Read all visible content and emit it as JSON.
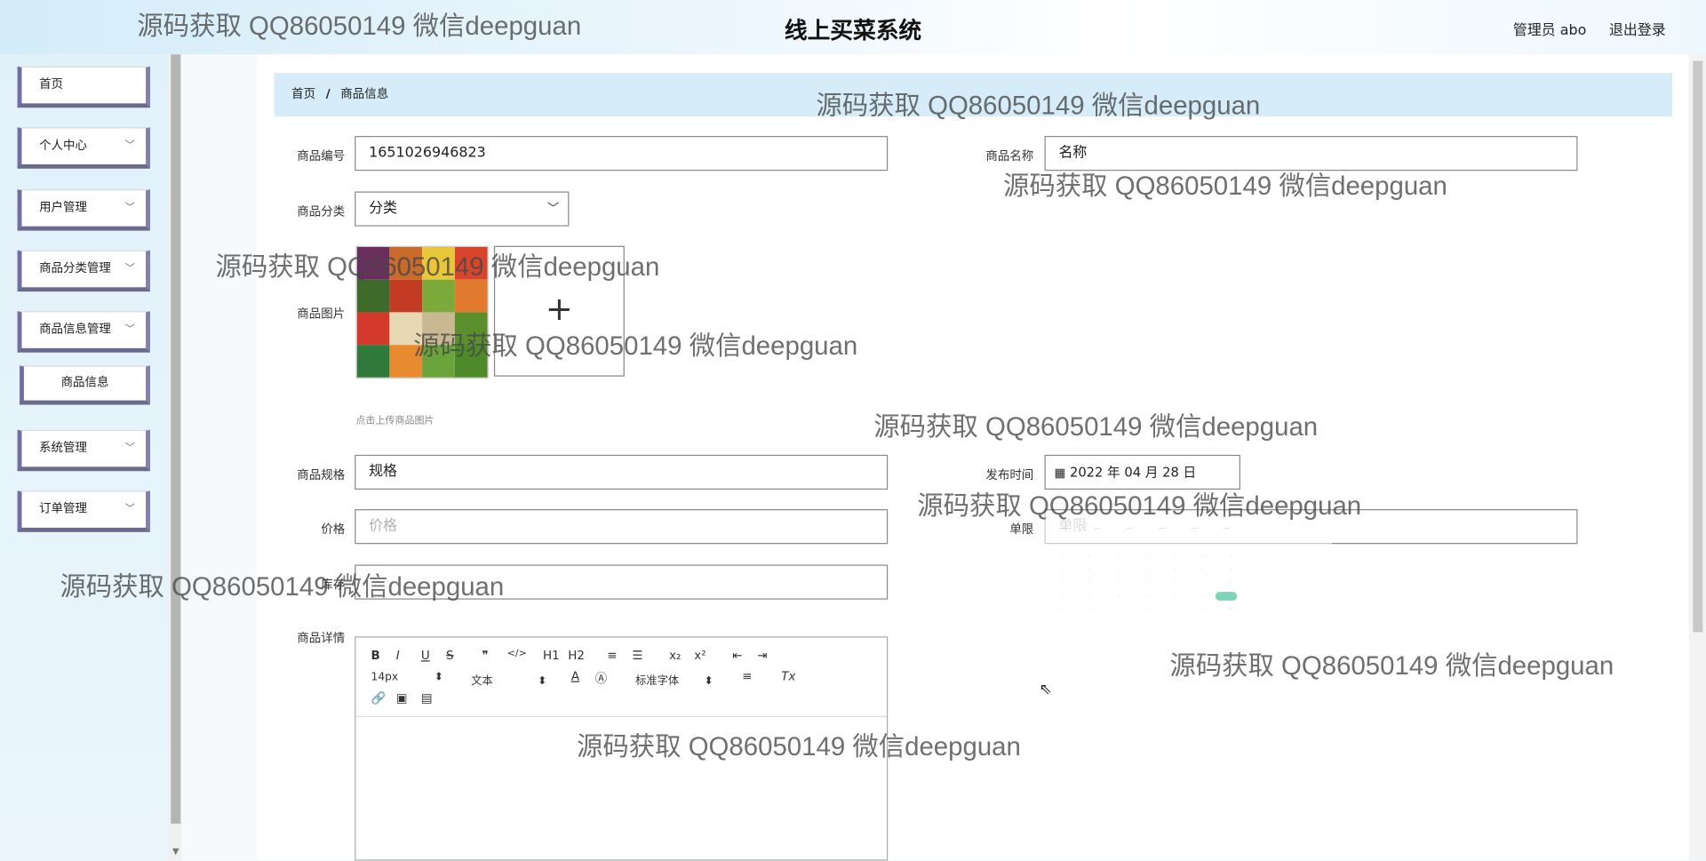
{
  "header": {
    "title": "线上买菜系统",
    "user": "管理员 abo",
    "logout": "退出登录"
  },
  "sidebar": {
    "items": [
      {
        "label": "首页",
        "expandable": false
      },
      {
        "label": "个人中心",
        "expandable": true
      },
      {
        "label": "用户管理",
        "expandable": true
      },
      {
        "label": "商品分类管理",
        "expandable": true
      },
      {
        "label": "商品信息管理",
        "expandable": true
      },
      {
        "label": "商品信息",
        "expandable": false,
        "sub": true
      },
      {
        "label": "系统管理",
        "expandable": true
      },
      {
        "label": "订单管理",
        "expandable": true
      }
    ],
    "chevron_icon": "chevron-down-icon"
  },
  "breadcrumb": {
    "home": "首页",
    "separator": "/",
    "current": "商品信息"
  },
  "form": {
    "code": {
      "label": "商品编号",
      "value": "1651026946823"
    },
    "name": {
      "label": "商品名称",
      "value": "名称"
    },
    "category": {
      "label": "商品分类",
      "value": "分类"
    },
    "image": {
      "label": "商品图片",
      "plus": "+",
      "hint": "点击上传商品图片"
    },
    "spec": {
      "label": "商品规格",
      "value": "规格"
    },
    "publish_date": {
      "label": "发布时间",
      "value": "2022 年 04 月 28 日"
    },
    "price": {
      "label": "价格",
      "placeholder": "价格"
    },
    "limit": {
      "label": "单限",
      "placeholder": "单限"
    },
    "stock": {
      "label": "库存",
      "value": ""
    },
    "detail": {
      "label": "商品详情"
    }
  },
  "editor": {
    "toolbar_row1": [
      "B",
      "I",
      "U",
      "S",
      "❞",
      "</>",
      "H1",
      "H2",
      "≡",
      "☰",
      "x₂",
      "x²",
      "⇤",
      "⇥"
    ],
    "font_size": "14px",
    "text_type": "文本",
    "font_family": "标准字体",
    "align_icon": "≡",
    "clear_icon": "Tx",
    "row3_icons": [
      "link-icon",
      "image-icon",
      "video-icon"
    ]
  },
  "watermark_text": "源码获取 QQ86050149 微信deepguan",
  "colors": {
    "header_gradient": "#d4ecf9",
    "breadcrumb_bg": "#d6ecf9",
    "menu_border": "#6a6a8c",
    "datepicker_selected": "#7fd3b6"
  }
}
